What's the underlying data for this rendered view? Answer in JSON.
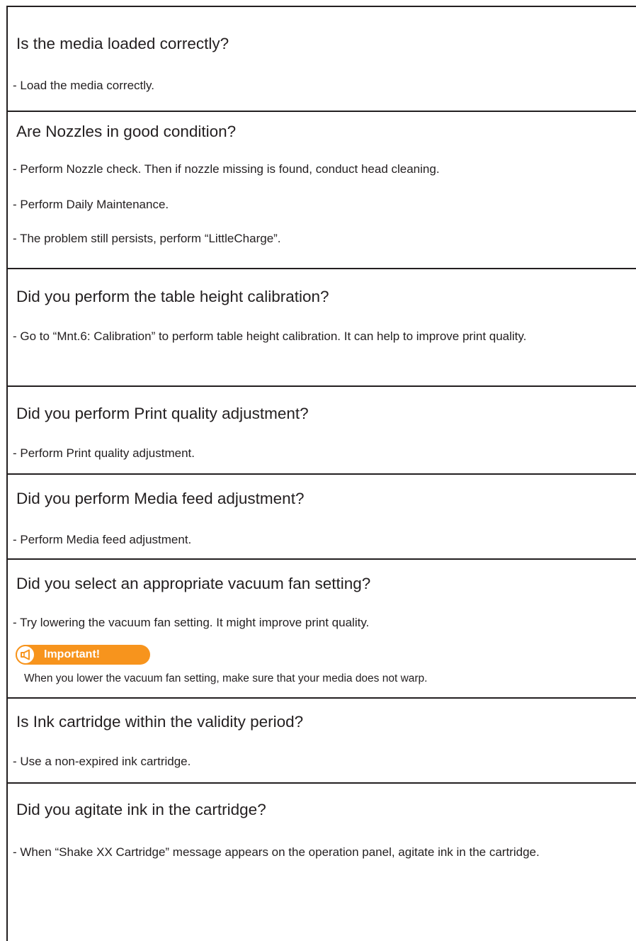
{
  "sections": [
    {
      "question": "Is the media loaded correctly?",
      "answers": [
        "- Load the media correctly."
      ]
    },
    {
      "question": "Are Nozzles in good condition?",
      "answers": [
        "- Perform Nozzle check. Then if nozzle missing is found, conduct head cleaning.",
        "- Perform Daily Maintenance.",
        "- The problem still persists, perform “LittleCharge”."
      ]
    },
    {
      "question": "Did you perform the table height calibration?",
      "answers": [
        "- Go to “Mnt.6: Calibration” to perform table height calibration. It can help to improve print quality."
      ]
    },
    {
      "question": "Did you perform Print quality adjustment?",
      "answers": [
        "- Perform Print quality adjustment."
      ]
    },
    {
      "question": "Did you perform Media feed adjustment?",
      "answers": [
        "- Perform Media feed adjustment."
      ]
    },
    {
      "question": "Did you select an appropriate vacuum fan setting?",
      "answers": [
        "- Try lowering the vacuum fan setting. It might improve print quality."
      ],
      "important": {
        "label": "Important!",
        "icon": "megaphone-icon",
        "text": "When you lower the vacuum fan setting, make sure that your media does not warp."
      }
    },
    {
      "question": "Is Ink cartridge within the validity period?",
      "answers": [
        "- Use a non-expired ink cartridge."
      ]
    },
    {
      "question": "Did you agitate ink in the cartridge?",
      "answers": [
        "- When “Shake XX Cartridge” message appears on the operation panel, agitate ink in the cartridge."
      ]
    }
  ],
  "colors": {
    "text": "#231f20",
    "accent": "#f7941d"
  }
}
